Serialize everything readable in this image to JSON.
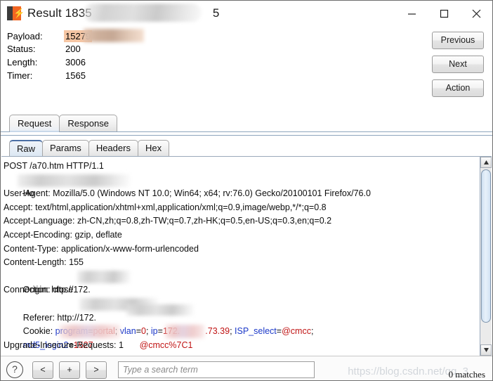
{
  "window": {
    "title_prefix": "Result 1835",
    "title_suffix": "5",
    "icon": "burp-suite-logo",
    "minimize_label": "–",
    "maximize_label": "☐",
    "close_label": "✕"
  },
  "summary": {
    "fields": [
      {
        "label": "Payload:",
        "value": "15279",
        "redacted": true
      },
      {
        "label": "Status:",
        "value": "200",
        "redacted": false
      },
      {
        "label": "Length:",
        "value": "3006",
        "redacted": false
      },
      {
        "label": "Timer:",
        "value": "1565",
        "redacted": false
      }
    ],
    "highlight_color": "#f6c6a4"
  },
  "buttons": {
    "previous": "Previous",
    "next": "Next",
    "action": "Action"
  },
  "tabs_outer": {
    "items": [
      {
        "label": "Request",
        "selected": true
      },
      {
        "label": "Response",
        "selected": false
      }
    ]
  },
  "tabs_inner": {
    "items": [
      {
        "label": "Raw",
        "selected": true
      },
      {
        "label": "Params",
        "selected": false
      },
      {
        "label": "Headers",
        "selected": false
      },
      {
        "label": "Hex",
        "selected": false
      }
    ],
    "selected_accent": "#4a6fa5"
  },
  "request": {
    "lines": [
      {
        "text": "POST /a70.htm HTTP/1.1"
      },
      {
        "text": "Ho"
      },
      {
        "text": "User-Agent: Mozilla/5.0 (Windows NT 10.0; Win64; x64; rv:76.0) Gecko/20100101 Firefox/76.0"
      },
      {
        "text": "Accept: text/html,application/xhtml+xml,application/xml;q=0.9,image/webp,*/*;q=0.8"
      },
      {
        "text": "Accept-Language: zh-CN,zh;q=0.8,zh-TW;q=0.7,zh-HK;q=0.5,en-US;q=0.3,en;q=0.2"
      },
      {
        "text": "Accept-Encoding: gzip, deflate"
      },
      {
        "text": "Content-Type: application/x-www-form-urlencoded"
      },
      {
        "text": "Content-Length: 155"
      },
      {
        "text": "Origin: http://172."
      },
      {
        "text": "Connection: close"
      },
      {
        "text": "Referer: http://172."
      }
    ],
    "cookie_line": {
      "prefix": "Cookie: ",
      "tokens": [
        {
          "text": "program",
          "color": "blue"
        },
        {
          "text": "=",
          "color": "plain"
        },
        {
          "text": "portal",
          "color": "red"
        },
        {
          "text": "; ",
          "color": "plain"
        },
        {
          "text": "vlan",
          "color": "blue"
        },
        {
          "text": "=",
          "color": "plain"
        },
        {
          "text": "0",
          "color": "red"
        },
        {
          "text": "; ",
          "color": "plain"
        },
        {
          "text": "ip",
          "color": "blue"
        },
        {
          "text": "=",
          "color": "plain"
        },
        {
          "text": "172.",
          "color": "red"
        },
        {
          "text": ".73.39",
          "color": "red"
        },
        {
          "text": "; ",
          "color": "plain"
        },
        {
          "text": "ISP_select",
          "color": "blue"
        },
        {
          "text": "=",
          "color": "plain"
        },
        {
          "text": "@cmcc",
          "color": "red"
        },
        {
          "text": ";",
          "color": "plain"
        }
      ]
    },
    "md5_line": {
      "tokens": [
        {
          "text": "md5_login2",
          "color": "blue"
        },
        {
          "text": "=",
          "color": "plain"
        },
        {
          "text": "1527",
          "color": "red"
        },
        {
          "text": "@cmcc%7C1",
          "color": "red"
        }
      ]
    },
    "last_line": "Upgrade-Insecure-Requests: 1"
  },
  "scrollbar": {
    "up_arrow": "▲",
    "down_arrow": "▼"
  },
  "bottombar": {
    "help": "?",
    "prev": "<",
    "plus": "+",
    "next": ">",
    "search_placeholder": "Type a search term",
    "search_value": "",
    "matches": "0 matches"
  },
  "watermark": "https://blog.csdn.net/qq_3"
}
